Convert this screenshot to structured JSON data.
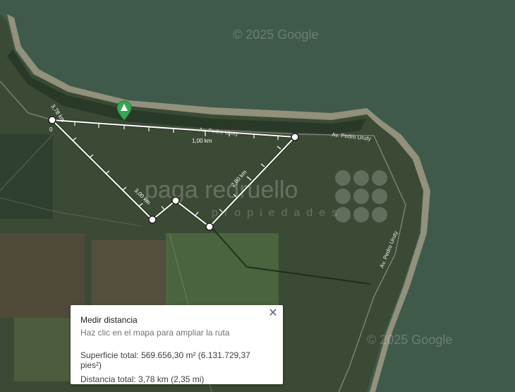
{
  "map": {
    "copyright_top": "© 2025 Google",
    "copyright_bottom": "© 2025 Google",
    "agency_watermark": "paga redruello",
    "agency_watermark_sub": "propiedades",
    "road_labels": [
      "Av. Pedro Uruty",
      "Av. Pedro Uruty",
      "Av. Pedro Uruty"
    ],
    "measure_labels": {
      "start_zero": "0",
      "total": "3,78 km",
      "km1": "1,00 km",
      "km2": "2,00 km",
      "km3": "3,00 km"
    },
    "colors": {
      "water": "#3f5a4b",
      "land": "#3b4a35",
      "beach": "#a89f88",
      "measure_line": "#ffffff",
      "marker": "#34a853"
    }
  },
  "measure_panel": {
    "title": "Medir distancia",
    "hint": "Haz clic en el mapa para ampliar la ruta",
    "area_label": "Superficie total:",
    "area_value": "569.656,30 m² (6.131.729,37 pies²)",
    "distance_label": "Distancia total:",
    "distance_value": "3,78 km (2,35 mi)",
    "close_icon": "close-icon"
  }
}
